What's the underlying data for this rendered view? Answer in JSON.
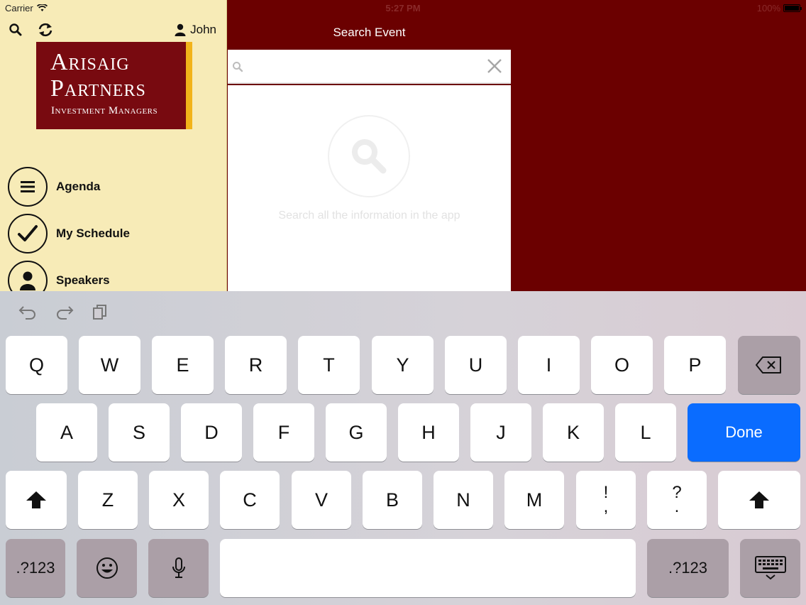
{
  "status_bar": {
    "carrier": "Carrier",
    "time": "5:27 PM",
    "battery": "100%"
  },
  "sidebar": {
    "user_name": "John",
    "logo": {
      "line1": "Arisaig",
      "line2": "Partners",
      "line3": "Investment Managers"
    },
    "menu": [
      {
        "label": "Agenda",
        "icon": "list-icon"
      },
      {
        "label": "My Schedule",
        "icon": "checkmark-icon"
      },
      {
        "label": "Speakers",
        "icon": "person-icon"
      }
    ]
  },
  "search": {
    "title": "Search Event",
    "input_value": "",
    "empty_text": "Search all the information in the app"
  },
  "keyboard": {
    "row1": [
      "Q",
      "W",
      "E",
      "R",
      "T",
      "Y",
      "U",
      "I",
      "O",
      "P"
    ],
    "row2": [
      "A",
      "S",
      "D",
      "F",
      "G",
      "H",
      "J",
      "K",
      "L"
    ],
    "row3": [
      "Z",
      "X",
      "C",
      "V",
      "B",
      "N",
      "M"
    ],
    "punct1": {
      "top": "!",
      "bottom": ","
    },
    "punct2": {
      "top": "?",
      "bottom": "."
    },
    "done_label": "Done",
    "numbers_label": ".?123"
  },
  "colors": {
    "brand_maroon": "#6b0000",
    "sidebar_bg": "#f7ebb7",
    "logo_accent": "#f2b31a",
    "done_blue": "#0a6cff"
  }
}
